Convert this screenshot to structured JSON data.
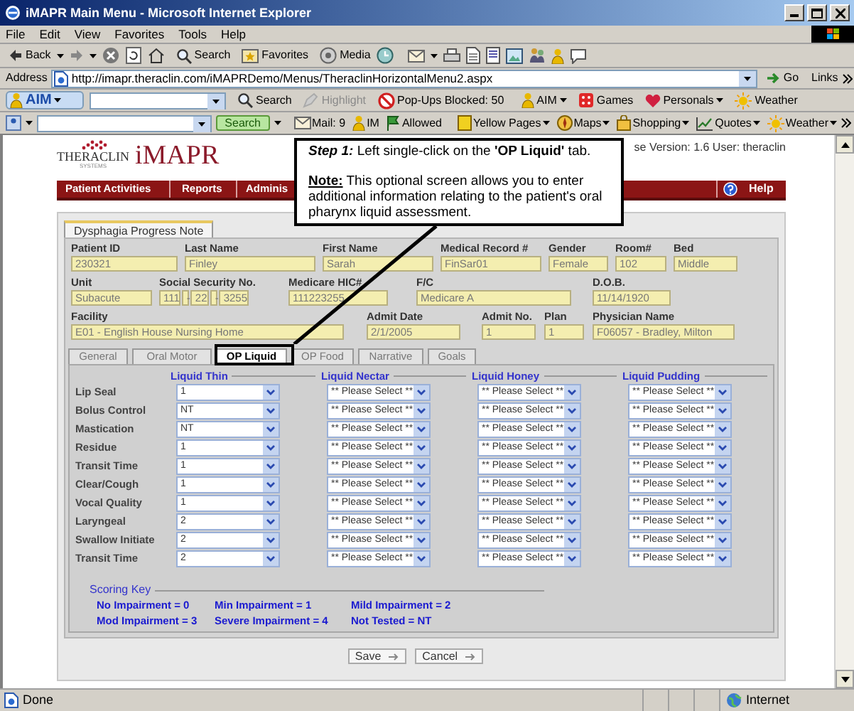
{
  "window": {
    "title": "iMAPR Main Menu - Microsoft Internet Explorer"
  },
  "menu": [
    "File",
    "Edit",
    "View",
    "Favorites",
    "Tools",
    "Help"
  ],
  "toolbar": {
    "back": "Back",
    "search": "Search",
    "favorites": "Favorites",
    "media": "Media"
  },
  "address_bar": {
    "label": "Address",
    "url": "http://imapr.theraclin.com/iMAPRDemo/Menus/TheraclinHorizontalMenu2.aspx",
    "go": "Go",
    "links": "Links"
  },
  "aim_toolbar": {
    "button": "AIM",
    "search": "Search",
    "highlight": {
      "label": "Highlight",
      "disabled": true
    },
    "popups": "Pop-Ups Blocked: 50",
    "links": [
      "AIM",
      "Games",
      "Personals",
      "Weather"
    ]
  },
  "search_toolbar": {
    "button": "Search",
    "links": [
      "Mail: 9",
      "IM",
      "Allowed",
      "Yellow Pages",
      "Maps",
      "Shopping",
      "Quotes",
      "Weather"
    ]
  },
  "header": {
    "logo_top": "THERACLIN",
    "logo_bottom": "SYSTEMS",
    "app_name": "iMAPR",
    "version": "se Version: 1.6 User: theraclin"
  },
  "nav": [
    "Patient Activities",
    "Reports",
    "Adminis"
  ],
  "help": "Help",
  "callout": {
    "step": "**Step 1:** Left single-click on the **'OP Liquid'** tab.",
    "note": "**Note:** This optional screen allows you to enter additional information relating to the patient's oral pharynx liquid assessment."
  },
  "form_tab": "Dysphagia Progress Note",
  "fields": [
    [
      {
        "kind": "text",
        "label": "Patient ID",
        "value": "230321"
      },
      {
        "kind": "text",
        "label": "Last Name",
        "value": "Finley"
      },
      {
        "kind": "text",
        "label": "First Name",
        "value": "Sarah"
      },
      {
        "kind": "text",
        "label": "Medical Record #",
        "value": "FinSar01"
      },
      {
        "kind": "text",
        "label": "Gender",
        "value": "Female"
      },
      {
        "kind": "text",
        "label": "Room#",
        "value": "102"
      },
      {
        "kind": "text",
        "label": "Bed",
        "value": "Middle"
      }
    ],
    [
      {
        "kind": "text",
        "label": "Unit",
        "value": "Subacute"
      },
      {
        "kind": "ssn",
        "label": "Social Security No.",
        "parts": [
          "111",
          "22",
          "3255"
        ],
        "separators": [
          "-",
          "-"
        ]
      },
      {
        "kind": "text",
        "label": "Medicare HIC#",
        "value": "111223255"
      },
      {
        "kind": "text",
        "label": "F/C",
        "value": "Medicare A"
      },
      {
        "kind": "text",
        "label": "D.O.B.",
        "value": "11/14/1920"
      }
    ],
    [
      {
        "kind": "text",
        "label": "Facility",
        "value": "E01 - English House Nursing Home"
      },
      {
        "kind": "text",
        "label": "Admit Date",
        "value": "2/1/2005"
      },
      {
        "kind": "text",
        "label": "Admit No.",
        "value": "1"
      },
      {
        "kind": "text",
        "label": "Plan",
        "value": "1"
      },
      {
        "kind": "text",
        "label": "Physician Name",
        "value": "F06057 - Bradley, Milton"
      }
    ]
  ],
  "sub_tabs": [
    {
      "label": "General",
      "selected": false
    },
    {
      "label": "Oral Motor",
      "selected": false
    },
    {
      "label": "OP Liquid",
      "selected": true
    },
    {
      "label": "OP Food",
      "selected": false
    },
    {
      "label": "Narrative",
      "selected": false
    },
    {
      "label": "Goals",
      "selected": false
    }
  ],
  "grid": {
    "columns": [
      "Liquid Thin",
      "Liquid Nectar",
      "Liquid Honey",
      "Liquid Pudding"
    ],
    "rows": [
      {
        "label": "Lip Seal",
        "values": [
          "1",
          "** Please Select **",
          "** Please Select **",
          "** Please Select **"
        ]
      },
      {
        "label": "Bolus Control",
        "values": [
          "NT",
          "** Please Select **",
          "** Please Select **",
          "** Please Select **"
        ]
      },
      {
        "label": "Mastication",
        "values": [
          "NT",
          "** Please Select **",
          "** Please Select **",
          "** Please Select **"
        ]
      },
      {
        "label": "Residue",
        "values": [
          "1",
          "** Please Select **",
          "** Please Select **",
          "** Please Select **"
        ]
      },
      {
        "label": "Transit Time",
        "values": [
          "1",
          "** Please Select **",
          "** Please Select **",
          "** Please Select **"
        ]
      },
      {
        "label": "Clear/Cough",
        "values": [
          "1",
          "** Please Select **",
          "** Please Select **",
          "** Please Select **"
        ]
      },
      {
        "label": "Vocal Quality",
        "values": [
          "1",
          "** Please Select **",
          "** Please Select **",
          "** Please Select **"
        ]
      },
      {
        "label": "Laryngeal",
        "values": [
          "2",
          "** Please Select **",
          "** Please Select **",
          "** Please Select **"
        ]
      },
      {
        "label": "Swallow Initiate",
        "values": [
          "2",
          "** Please Select **",
          "** Please Select **",
          "** Please Select **"
        ]
      },
      {
        "label": "Transit Time",
        "values": [
          "2",
          "** Please Select **",
          "** Please Select **",
          "** Please Select **"
        ]
      }
    ]
  },
  "scoring_key": {
    "title": "Scoring Key",
    "items": [
      "No Impairment = 0",
      "Min Impairment = 1",
      "Mild Impairment = 2",
      "Mod Impairment = 3",
      "Severe Impairment = 4",
      "Not Tested = NT"
    ]
  },
  "buttons": [
    "Save",
    "Cancel"
  ],
  "status_bar": {
    "status": "Done",
    "zone": "Internet"
  }
}
